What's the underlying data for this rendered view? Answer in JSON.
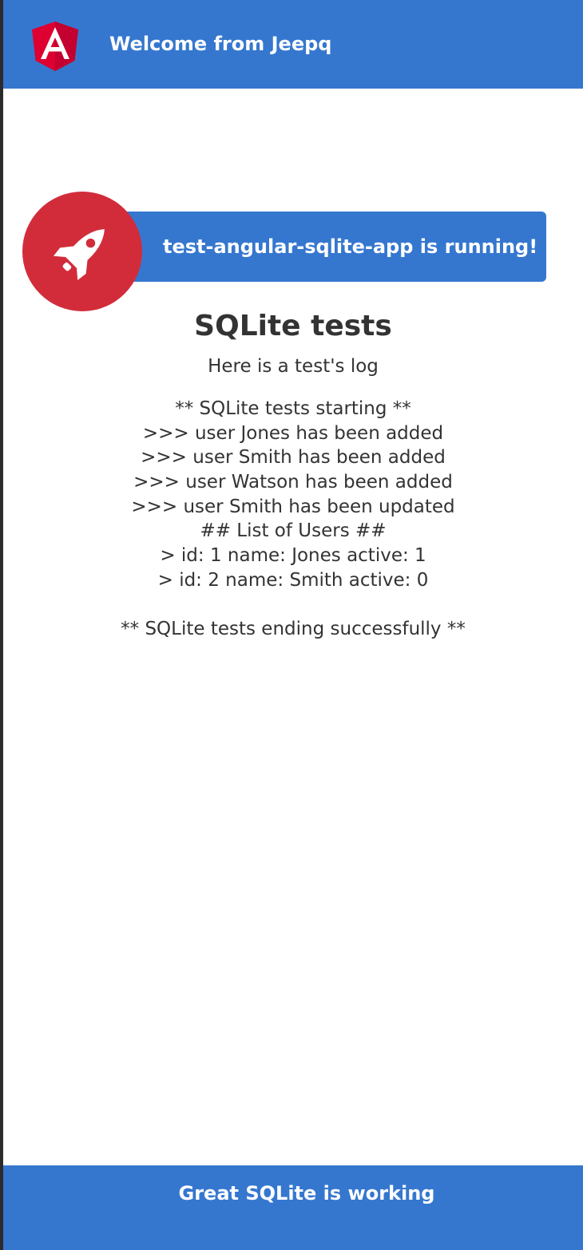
{
  "toolbar": {
    "logo_icon": "angular-logo-icon",
    "title": "Welcome from Jeepq"
  },
  "banner": {
    "icon": "rocket-icon",
    "text": "test-angular-sqlite-app is running!"
  },
  "main": {
    "heading": "SQLite tests",
    "subheading": "Here is a test's log",
    "log": [
      "** SQLite tests starting **",
      ">>> user Jones has been added",
      ">>> user Smith has been added",
      ">>> user Watson has been added",
      ">>> user Smith has been updated",
      "## List of Users ##",
      "> id: 1 name: Jones active: 1",
      "> id: 2 name: Smith active: 0",
      "",
      "** SQLite tests ending successfully **"
    ]
  },
  "footer": {
    "text": "Great SQLite is working"
  },
  "colors": {
    "primary": "#3577cf",
    "accent_red": "#d22c3b",
    "text": "#333333",
    "background": "#ffffff"
  }
}
